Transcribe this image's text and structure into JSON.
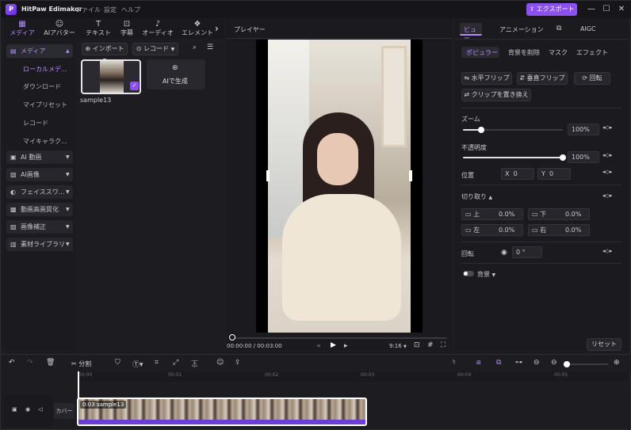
{
  "app": {
    "title": "HitPaw Edimakor",
    "menu": [
      "ファイル",
      "設定",
      "ヘルプ"
    ],
    "export_label": "エクスポート"
  },
  "toolbar": {
    "tabs": [
      "メディア",
      "AIアバター",
      "テキスト",
      "字幕",
      "オーディオ",
      "エレメント"
    ]
  },
  "sidebar": {
    "top": "メディア",
    "subitems": [
      "ローカルメデ...",
      "ダウンロード",
      "マイプリセット",
      "レコード",
      "マイキャラク..."
    ],
    "items": [
      "AI 動画",
      "AI画像",
      "フェイススワ...",
      "動画高画質化",
      "画像補正",
      "素材ライブラリ"
    ]
  },
  "media": {
    "import_label": "インポート",
    "record_label": "レコード",
    "clip_name": "sample13",
    "ai_generate": "AIで生成"
  },
  "player": {
    "title": "プレイヤー",
    "time": "00:00:00 / 00:03:00",
    "ratio": "9:16"
  },
  "right": {
    "tabs": [
      "ビュー",
      "アニメーション",
      "AIGC"
    ],
    "subtabs": [
      "ポピュラー",
      "背景を削除",
      "マスク",
      "エフェクト"
    ],
    "buttons": [
      "水平フリップ",
      "垂直フリップ",
      "回転",
      "クリップを置き換え"
    ],
    "zoom_label": "ズーム",
    "zoom_value": "100%",
    "zoom_level": 0.18,
    "opacity_label": "不透明度",
    "opacity_value": "100%",
    "opacity_level": 1.0,
    "position_label": "位置",
    "x_label": "X",
    "x_value": "0",
    "y_label": "Y",
    "y_value": "0",
    "crop_label": "切り取り",
    "crop": [
      {
        "label": "上",
        "value": "0.0%"
      },
      {
        "label": "下",
        "value": "0.0%"
      },
      {
        "label": "左",
        "value": "0.0%"
      },
      {
        "label": "右",
        "value": "0.0%"
      }
    ],
    "rotate_label": "回転",
    "rotate_value": "0",
    "rotate_unit": "°",
    "background_label": "背景",
    "reset_label": "リセット"
  },
  "timeline": {
    "split_label": "分割",
    "ruler": [
      "00:00",
      "00:01",
      "00:02",
      "00:03",
      "00:04",
      "00:05"
    ],
    "cover_label": "カバー",
    "clip_label": "0:03 sample13"
  },
  "colors": {
    "accent": "#8c4ff0",
    "accent_text": "#b48cff",
    "bg": "#1d1d21"
  }
}
